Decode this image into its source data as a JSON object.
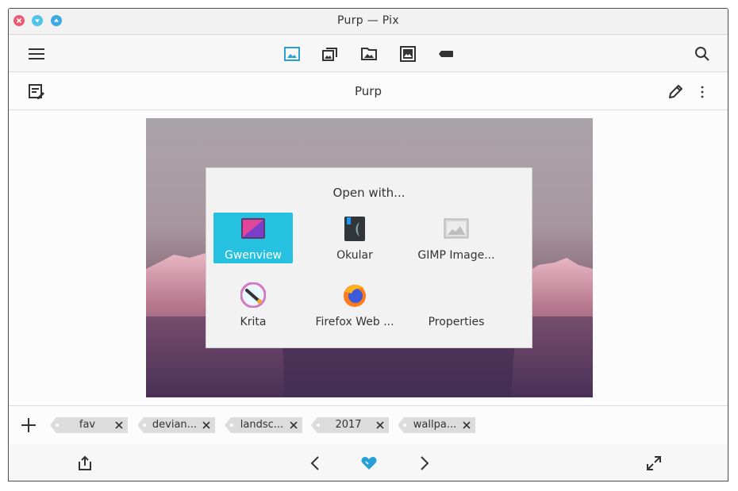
{
  "window": {
    "title": "Purp — Pix",
    "buttons": {
      "close_color": "#ed5a74",
      "minimize_color": "#4fc3e8",
      "maximize_color": "#3fa9e6"
    }
  },
  "toolbar": {
    "icons": [
      "hamburger-menu-icon",
      "image-icon",
      "collection-icon",
      "folder-image-icon",
      "image-frame-icon",
      "tag-icon",
      "search-icon"
    ],
    "active_color": "#2a9fd8"
  },
  "subbar": {
    "title": "Purp"
  },
  "dialog": {
    "title": "Open with...",
    "apps": [
      {
        "label": "Gwenview",
        "icon": "gwenview-icon",
        "selected": true
      },
      {
        "label": "Okular",
        "icon": "okular-icon"
      },
      {
        "label": "GIMP Image...",
        "icon": "gimp-image-icon"
      },
      {
        "label": "Krita",
        "icon": "krita-icon"
      },
      {
        "label": "Firefox Web ...",
        "icon": "firefox-icon"
      },
      {
        "label": "Properties",
        "icon": ""
      }
    ],
    "selected_color": "#26c1e0"
  },
  "tags": [
    "fav",
    "devian...",
    "landsc...",
    "2017",
    "wallpa..."
  ],
  "bottom": {
    "favorite_color": "#2a9fd8"
  }
}
